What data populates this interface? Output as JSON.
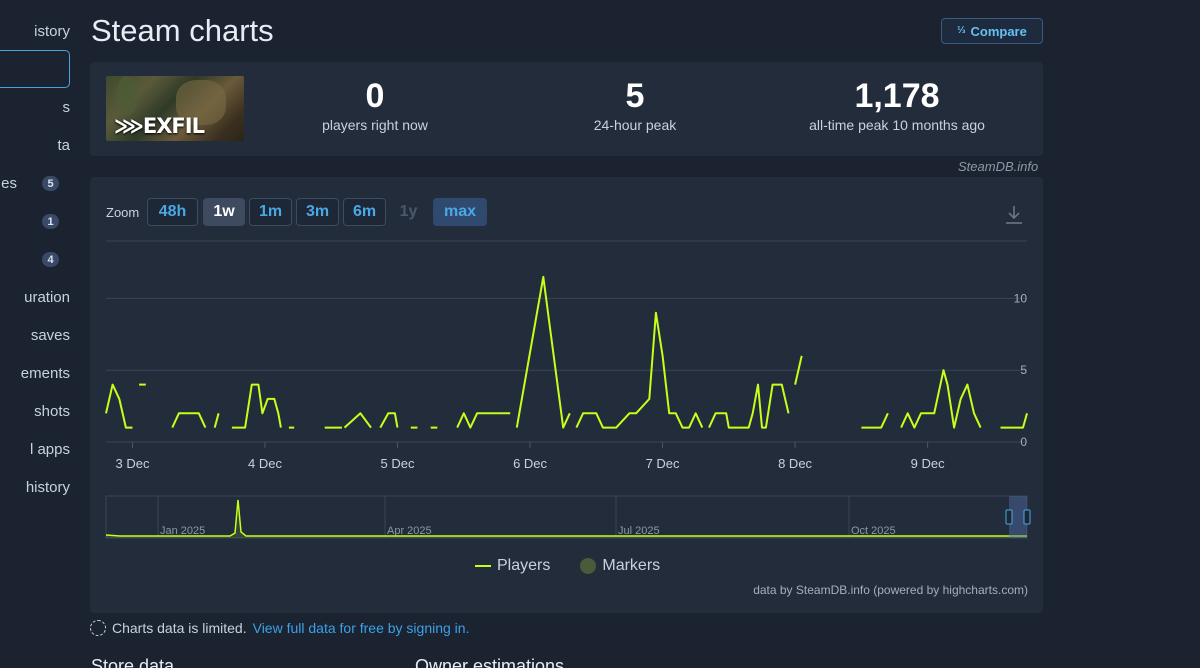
{
  "sidebar": {
    "items": [
      {
        "label": "istory",
        "badge": ""
      },
      {
        "label": "",
        "badge": ""
      },
      {
        "label": "s",
        "badge": ""
      },
      {
        "label": "ta",
        "badge": ""
      },
      {
        "label": "es",
        "badge": "5"
      },
      {
        "label": "",
        "badge": "1"
      },
      {
        "label": "",
        "badge": "4"
      },
      {
        "label": "uration",
        "badge": ""
      },
      {
        "label": "saves",
        "badge": ""
      },
      {
        "label": "ements",
        "badge": ""
      },
      {
        "label": "shots",
        "badge": ""
      },
      {
        "label": "l apps",
        "badge": ""
      },
      {
        "label": "history",
        "badge": ""
      }
    ]
  },
  "header": {
    "title": "Steam charts",
    "compare_label": "Compare",
    "compare_icon": "1/2/3"
  },
  "game": {
    "capsule_logo": "EXFIL"
  },
  "stats": [
    {
      "value": "0",
      "label": "players right now"
    },
    {
      "value": "5",
      "label": "24-hour peak"
    },
    {
      "value": "1,178",
      "label": "all-time peak 10 months ago"
    }
  ],
  "credit": "SteamDB.info",
  "zoom": {
    "label": "Zoom",
    "buttons": [
      {
        "label": "48h",
        "state": "normal"
      },
      {
        "label": "1w",
        "state": "active"
      },
      {
        "label": "1m",
        "state": "normal"
      },
      {
        "label": "3m",
        "state": "normal"
      },
      {
        "label": "6m",
        "state": "normal"
      },
      {
        "label": "1y",
        "state": "disabled"
      },
      {
        "label": "max",
        "state": "max"
      }
    ]
  },
  "chart_data": {
    "type": "line",
    "series": [
      {
        "name": "Players",
        "color": "#c6ff1a"
      }
    ],
    "legend": [
      {
        "name": "Players",
        "color": "#c6ff1a"
      },
      {
        "name": "Markers",
        "color": "#4b5a38"
      }
    ],
    "legend_position": "bottom-center",
    "grid": true,
    "ylim": [
      0,
      14
    ],
    "ytick_labels": [
      "0",
      "5",
      "10"
    ],
    "x_tick_labels": [
      "3 Dec",
      "4 Dec",
      "5 Dec",
      "6 Dec",
      "7 Dec",
      "8 Dec",
      "9 Dec"
    ],
    "x_start": 2.8,
    "x_end": 9.75,
    "segments": [
      [
        [
          2.8,
          2
        ],
        [
          2.85,
          4
        ],
        [
          2.9,
          3
        ],
        [
          2.95,
          1
        ],
        [
          3.0,
          1
        ]
      ],
      [
        [
          3.05,
          4
        ],
        [
          3.1,
          4
        ]
      ],
      [
        [
          3.3,
          1
        ],
        [
          3.35,
          2
        ],
        [
          3.5,
          2
        ],
        [
          3.55,
          1
        ]
      ],
      [
        [
          3.62,
          1
        ],
        [
          3.65,
          2
        ]
      ],
      [
        [
          3.75,
          1
        ],
        [
          3.85,
          1
        ],
        [
          3.9,
          4
        ],
        [
          3.95,
          4
        ],
        [
          3.98,
          2
        ],
        [
          4.02,
          3
        ],
        [
          4.07,
          3
        ],
        [
          4.1,
          2
        ],
        [
          4.12,
          1
        ]
      ],
      [
        [
          4.18,
          1
        ],
        [
          4.22,
          1
        ]
      ],
      [
        [
          4.45,
          1
        ],
        [
          4.58,
          1
        ]
      ],
      [
        [
          4.6,
          1
        ],
        [
          4.72,
          2
        ],
        [
          4.8,
          1
        ]
      ],
      [
        [
          4.87,
          1
        ],
        [
          4.93,
          2
        ],
        [
          4.98,
          2
        ],
        [
          5.0,
          1
        ]
      ],
      [
        [
          5.1,
          1
        ],
        [
          5.15,
          1
        ]
      ],
      [
        [
          5.25,
          1
        ],
        [
          5.3,
          1
        ]
      ],
      [
        [
          5.45,
          1
        ],
        [
          5.5,
          2
        ],
        [
          5.55,
          1
        ],
        [
          5.6,
          2
        ],
        [
          5.8,
          2
        ],
        [
          5.85,
          2
        ]
      ],
      [
        [
          5.9,
          1
        ],
        [
          6.1,
          11.5
        ],
        [
          6.15,
          8
        ],
        [
          6.25,
          1
        ],
        [
          6.3,
          2
        ]
      ],
      [
        [
          6.35,
          1
        ],
        [
          6.4,
          2
        ],
        [
          6.5,
          2
        ],
        [
          6.55,
          1
        ],
        [
          6.6,
          1
        ],
        [
          6.65,
          1
        ],
        [
          6.75,
          2
        ],
        [
          6.8,
          2
        ],
        [
          6.9,
          3
        ],
        [
          6.95,
          9
        ],
        [
          7.0,
          6
        ],
        [
          7.05,
          2
        ],
        [
          7.1,
          2
        ],
        [
          7.15,
          1
        ],
        [
          7.2,
          1
        ],
        [
          7.25,
          2
        ],
        [
          7.3,
          1
        ]
      ],
      [
        [
          7.35,
          1
        ],
        [
          7.4,
          2
        ],
        [
          7.48,
          2
        ],
        [
          7.5,
          1
        ],
        [
          7.65,
          1
        ],
        [
          7.68,
          2
        ],
        [
          7.72,
          4
        ],
        [
          7.75,
          1
        ],
        [
          7.78,
          1
        ],
        [
          7.83,
          4
        ],
        [
          7.9,
          4
        ],
        [
          7.95,
          2
        ]
      ],
      [
        [
          8.0,
          4
        ],
        [
          8.05,
          6
        ]
      ],
      [
        [
          8.5,
          1
        ],
        [
          8.65,
          1
        ],
        [
          8.7,
          2
        ]
      ],
      [
        [
          8.8,
          1
        ],
        [
          8.85,
          2
        ],
        [
          8.9,
          1
        ],
        [
          8.95,
          2
        ],
        [
          9.05,
          2
        ],
        [
          9.12,
          5
        ],
        [
          9.15,
          4
        ],
        [
          9.2,
          1
        ],
        [
          9.25,
          3
        ],
        [
          9.3,
          4
        ],
        [
          9.35,
          2
        ],
        [
          9.4,
          1
        ]
      ],
      [
        [
          9.55,
          1
        ],
        [
          9.72,
          1
        ],
        [
          9.75,
          2
        ]
      ]
    ],
    "navigator": {
      "type": "area",
      "tick_labels": [
        "Jan 2025",
        "Apr 2025",
        "Jul 2025",
        "Oct 2025"
      ],
      "spike_month": "Jan 2025"
    }
  },
  "footer": {
    "limited_text": "Charts data is limited.",
    "limited_link": "View full data for free by signing in.",
    "chart_credit": "data by SteamDB.info (powered by highcharts.com)",
    "section_left": "Store data",
    "section_right": "Owner estimations"
  }
}
